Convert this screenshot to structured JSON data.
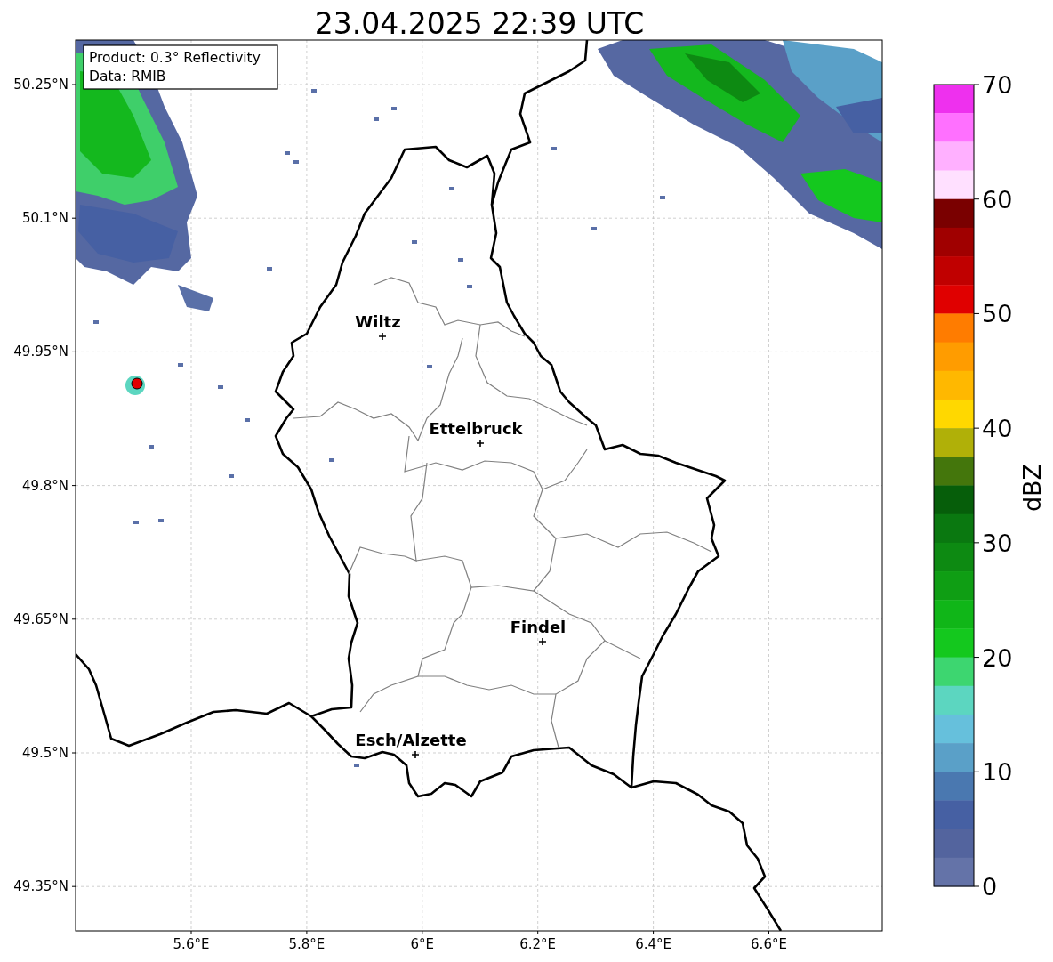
{
  "title": "23.04.2025 22:39 UTC",
  "info_box": [
    "Product: 0.3° Reflectivity",
    "Data: RMIB"
  ],
  "map": {
    "lat_ticks": [
      "50.25°N",
      "50.1°N",
      "49.95°N",
      "49.8°N",
      "49.65°N",
      "49.5°N",
      "49.35°N"
    ],
    "lon_ticks": [
      "5.6°E",
      "5.8°E",
      "6°E",
      "6.2°E",
      "6.4°E",
      "6.6°E"
    ],
    "cities": [
      {
        "name": "Wiltz"
      },
      {
        "name": "Ettelbruck"
      },
      {
        "name": "Findel"
      },
      {
        "name": "Esch/Alzette"
      }
    ]
  },
  "colorbar": {
    "label": "dBZ",
    "ticks": [
      "70",
      "60",
      "50",
      "40",
      "30",
      "20",
      "10",
      "0"
    ],
    "bins": [
      {
        "color": "#ee30ee"
      },
      {
        "color": "#ff70ff"
      },
      {
        "color": "#ffb0ff"
      },
      {
        "color": "#ffe0ff"
      },
      {
        "color": "#7a0000"
      },
      {
        "color": "#a00000"
      },
      {
        "color": "#c00000"
      },
      {
        "color": "#e00000"
      },
      {
        "color": "#ff7c00"
      },
      {
        "color": "#ff9c00"
      },
      {
        "color": "#ffb800"
      },
      {
        "color": "#ffd800"
      },
      {
        "color": "#b0b008"
      },
      {
        "color": "#44760c"
      },
      {
        "color": "#065e0a"
      },
      {
        "color": "#0a7810"
      },
      {
        "color": "#0d8a12"
      },
      {
        "color": "#0f9e14"
      },
      {
        "color": "#10b618"
      },
      {
        "color": "#14c81e"
      },
      {
        "color": "#3dd670"
      },
      {
        "color": "#5cd6c0"
      },
      {
        "color": "#66c0dc"
      },
      {
        "color": "#5aa0c8"
      },
      {
        "color": "#4a78b0"
      },
      {
        "color": "#4660a3"
      },
      {
        "color": "#53649e"
      },
      {
        "color": "#6473a8"
      }
    ]
  }
}
